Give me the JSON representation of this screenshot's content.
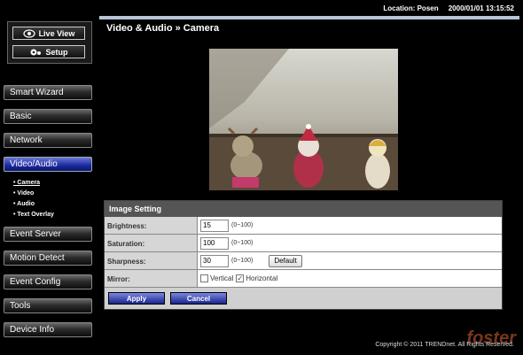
{
  "topbar": {
    "location": "Location: Posen     2000/01/01 13:15:52"
  },
  "view": {
    "live_view": "Live View",
    "setup": "Setup"
  },
  "menu": {
    "smart_wizard": "Smart Wizard",
    "basic": "Basic",
    "network": "Network",
    "video_audio": "Video/Audio",
    "sub": [
      "• Camera",
      "• Video",
      "• Audio",
      "• Text Overlay"
    ],
    "event_server": "Event Server",
    "motion_detect": "Motion Detect",
    "event_config": "Event Config",
    "tools": "Tools",
    "device_info": "Device Info"
  },
  "page": {
    "title": "Video & Audio » Camera"
  },
  "image_setting": {
    "title": "Image Setting",
    "brightness_label": "Brightness:",
    "brightness_value": "15",
    "brightness_range": "(0~100)",
    "saturation_label": "Saturation:",
    "saturation_value": "100",
    "saturation_range": "(0~100)",
    "sharpness_label": "Sharpness:",
    "sharpness_value": "30",
    "sharpness_range": "(0~100)",
    "default_label": "Default",
    "mirror_label": "Mirror:",
    "vertical_label": "Vertical",
    "horizontal_label": "Horizontal"
  },
  "actions": {
    "apply": "Apply",
    "cancel": "Cancel"
  },
  "footer": {
    "copyright": "Copyright © 2011 TRENDnet. All Rights Reserved.",
    "watermark": "foster"
  },
  "colors": {
    "active_menu": "#1b2a9c",
    "header_rule": "#b8c4d8"
  }
}
